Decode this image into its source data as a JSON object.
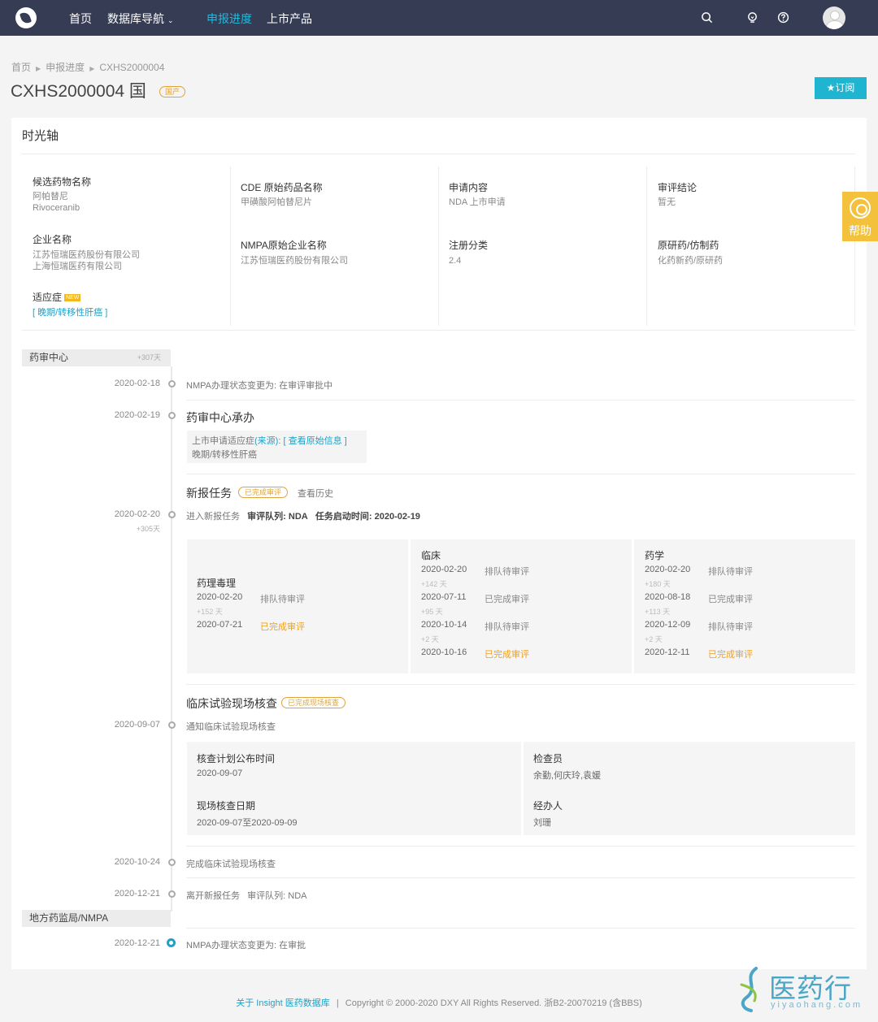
{
  "nav": {
    "items": [
      "首页",
      "数据库导航",
      "申报进度",
      "上市产品"
    ],
    "active": "申报进度"
  },
  "breadcrumb": [
    "首页",
    "申报进度",
    "CXHS2000004"
  ],
  "header": {
    "title": "CXHS2000004 国",
    "badge": "国产",
    "subscribe": "★订阅"
  },
  "card": {
    "title": "时光轴"
  },
  "help": {
    "label": "帮助"
  },
  "info": {
    "candidate_label": "候选药物名称",
    "candidate_cn": "阿帕替尼",
    "candidate_en": "Rivoceranib",
    "cde_label": "CDE 原始药品名称",
    "cde_value": "甲磺酸阿帕替尼片",
    "apply_label": "申请内容",
    "apply_value": "NDA 上市申请",
    "review_label": "审评结论",
    "review_value": "暂无",
    "company_label": "企业名称",
    "company_1": "江苏恒瑞医药股份有限公司",
    "company_2": "上海恒瑞医药有限公司",
    "nmpa_company_label": "NMPA原始企业名称",
    "nmpa_company_value": "江苏恒瑞医药股份有限公司",
    "reg_label": "注册分类",
    "reg_value": "2.4",
    "orig_label": "原研药/仿制药",
    "orig_value": "化药新药/原研药",
    "indication_label": "适应症",
    "indication_new": "NEW",
    "indication_value": "[ 晚期/转移性肝癌 ]"
  },
  "timeline": {
    "group1": {
      "name": "药审中心",
      "days": "+307天"
    },
    "e1": {
      "date": "2020-02-18",
      "text": "NMPA办理状态变更为: 在审评审批中"
    },
    "e2": {
      "date": "2020-02-19",
      "heading": "药审中心承办",
      "note_prefix": "上市申请适应症",
      "note_source": "(来源)",
      "note_colon": ":",
      "note_link": "[ 查看原始信息 ]",
      "note_value": "晚期/转移性肝癌"
    },
    "e3": {
      "heading": "新报任务",
      "badge": "已完成审评",
      "history": "查看历史",
      "date": "2020-02-20",
      "days": "+305天",
      "text": "进入新报任务",
      "queue_label": "审评队列:",
      "queue_value": "NDA",
      "start_label": "任务启动时间:",
      "start_value": "2020-02-19"
    },
    "panels": [
      {
        "title": "药理毒理",
        "rows": [
          {
            "date": "2020-02-20",
            "status": "排队待审评",
            "done": false,
            "days": "+152 天"
          },
          {
            "date": "2020-07-21",
            "status": "已完成审评",
            "done": true,
            "days": ""
          }
        ]
      },
      {
        "title": "临床",
        "rows": [
          {
            "date": "2020-02-20",
            "status": "排队待审评",
            "done": false,
            "days": "+142 天"
          },
          {
            "date": "2020-07-11",
            "status": "已完成审评",
            "done": false,
            "days": "+95 天"
          },
          {
            "date": "2020-10-14",
            "status": "排队待审评",
            "done": false,
            "days": "+2 天"
          },
          {
            "date": "2020-10-16",
            "status": "已完成审评",
            "done": true,
            "days": ""
          }
        ]
      },
      {
        "title": "药学",
        "rows": [
          {
            "date": "2020-02-20",
            "status": "排队待审评",
            "done": false,
            "days": "+180 天"
          },
          {
            "date": "2020-08-18",
            "status": "已完成审评",
            "done": false,
            "days": "+113 天"
          },
          {
            "date": "2020-12-09",
            "status": "排队待审评",
            "done": false,
            "days": "+2 天"
          },
          {
            "date": "2020-12-11",
            "status": "已完成审评",
            "done": true,
            "days": ""
          }
        ]
      }
    ],
    "e4": {
      "heading": "临床试验现场核查",
      "badge": "已完成现场核查",
      "date": "2020-09-07",
      "text": "通知临床试验现场核查",
      "plan_label": "核查计划公布时间",
      "plan_value": "2020-09-07",
      "inspector_label": "检查员",
      "inspector_value": "余勤,何庆玲,袁媛",
      "onsite_label": "现场核查日期",
      "onsite_value": "2020-09-07至2020-09-09",
      "handler_label": "经办人",
      "handler_value": "刘珊"
    },
    "e5": {
      "date": "2020-10-24",
      "text": "完成临床试验现场核查"
    },
    "e6": {
      "date": "2020-12-21",
      "text": "离开新报任务",
      "queue": "审评队列: NDA"
    },
    "group2": {
      "name": "地方药监局/NMPA"
    },
    "e7": {
      "date": "2020-12-21",
      "text": "NMPA办理状态变更为: 在审批"
    }
  },
  "footer": {
    "link": "关于 Insight 医药数据库",
    "sep": "|",
    "copyright": "Copyright © 2000-2020 DXY All Rights Reserved. 浙B2-20070219 (含BBS)"
  },
  "watermark": {
    "text": "医药行",
    "sub": "yiyaohang.com"
  },
  "colors": {
    "nav_bg": "#353c54",
    "accent": "#1fb4cf",
    "warn": "#f0a020",
    "help_bg": "#f3c13c"
  }
}
